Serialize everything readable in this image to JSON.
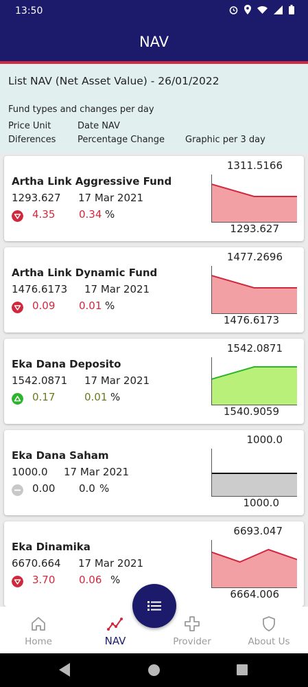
{
  "status_bar": {
    "time": "13:50",
    "icons": [
      "alarm-icon",
      "location-icon",
      "wifi-icon",
      "signal-icon",
      "battery-icon"
    ]
  },
  "app_bar": {
    "title": "NAV"
  },
  "header": {
    "title": "List NAV (Net Asset Value) - 26/01/2022",
    "subtitle": "Fund types and changes per day",
    "labels": {
      "price_unit": "Price Unit",
      "date_nav": "Date NAV",
      "differences": "Diferences",
      "percentage_change": "Percentage Change",
      "graphic": "Graphic per 3 day"
    }
  },
  "colors": {
    "primary": "#1c1a6b",
    "accent_line": "#d0283c",
    "down": "#d0283c",
    "up": "#2cb52c",
    "neutral": "#c8c8c8",
    "down_fill": "#f2a0a4",
    "up_fill": "#b8f07a",
    "neutral_fill": "#cccccc"
  },
  "funds": [
    {
      "name": "Artha Link Aggressive Fund",
      "price": "1293.627",
      "date": "17 Mar 2021",
      "trend": "down",
      "diff": "4.35",
      "pct": "0.34",
      "pct_unit": "%",
      "graph_max": "1311.5166",
      "graph_min": "1293.627",
      "graph_values": [
        1311.5166,
        1293.627,
        1293.627
      ]
    },
    {
      "name": "Artha Link Dynamic Fund",
      "price": "1476.6173",
      "date": "17 Mar 2021",
      "trend": "down",
      "diff": "0.09",
      "pct": "0.01",
      "pct_unit": "%",
      "graph_max": "1477.2696",
      "graph_min": "1476.6173",
      "graph_values": [
        1477.2696,
        1476.6173,
        1476.6173
      ]
    },
    {
      "name": "Eka Dana Deposito",
      "price": "1542.0871",
      "date": "17 Mar 2021",
      "trend": "up",
      "diff": "0.17",
      "pct": "0.01",
      "pct_unit": "%",
      "graph_max": "1542.0871",
      "graph_min": "1540.9059",
      "graph_values": [
        1540.9059,
        1542.0871,
        1542.0871
      ]
    },
    {
      "name": "Eka Dana Saham",
      "price": "1000.0",
      "date": "17 Mar 2021",
      "trend": "flat",
      "diff": "0.00",
      "pct": "0.0",
      "pct_unit": "%",
      "graph_max": "1000.0",
      "graph_min": "1000.0",
      "graph_values": [
        1000.0,
        1000.0,
        1000.0
      ]
    },
    {
      "name": "Eka Dinamika",
      "price": "6670.664",
      "date": "17 Mar 2021",
      "trend": "down",
      "diff": "3.70",
      "pct": "0.06",
      "pct_unit": "%",
      "graph_max": "6693.047",
      "graph_min": "6664.006",
      "graph_values": [
        6675.0,
        6673.0,
        6675.5,
        6673.5
      ]
    }
  ],
  "bottom_nav": {
    "items": [
      {
        "label": "Home",
        "icon": "home-icon",
        "active": false
      },
      {
        "label": "NAV",
        "icon": "nav-chart-icon",
        "active": true
      },
      {
        "label": "Provider",
        "icon": "provider-cross-icon",
        "active": false
      },
      {
        "label": "About Us",
        "icon": "shield-icon",
        "active": false
      }
    ]
  },
  "fab": {
    "icon": "list-icon"
  },
  "system_nav": {
    "icons": [
      "back-icon",
      "home-circle-icon",
      "recents-icon"
    ]
  }
}
